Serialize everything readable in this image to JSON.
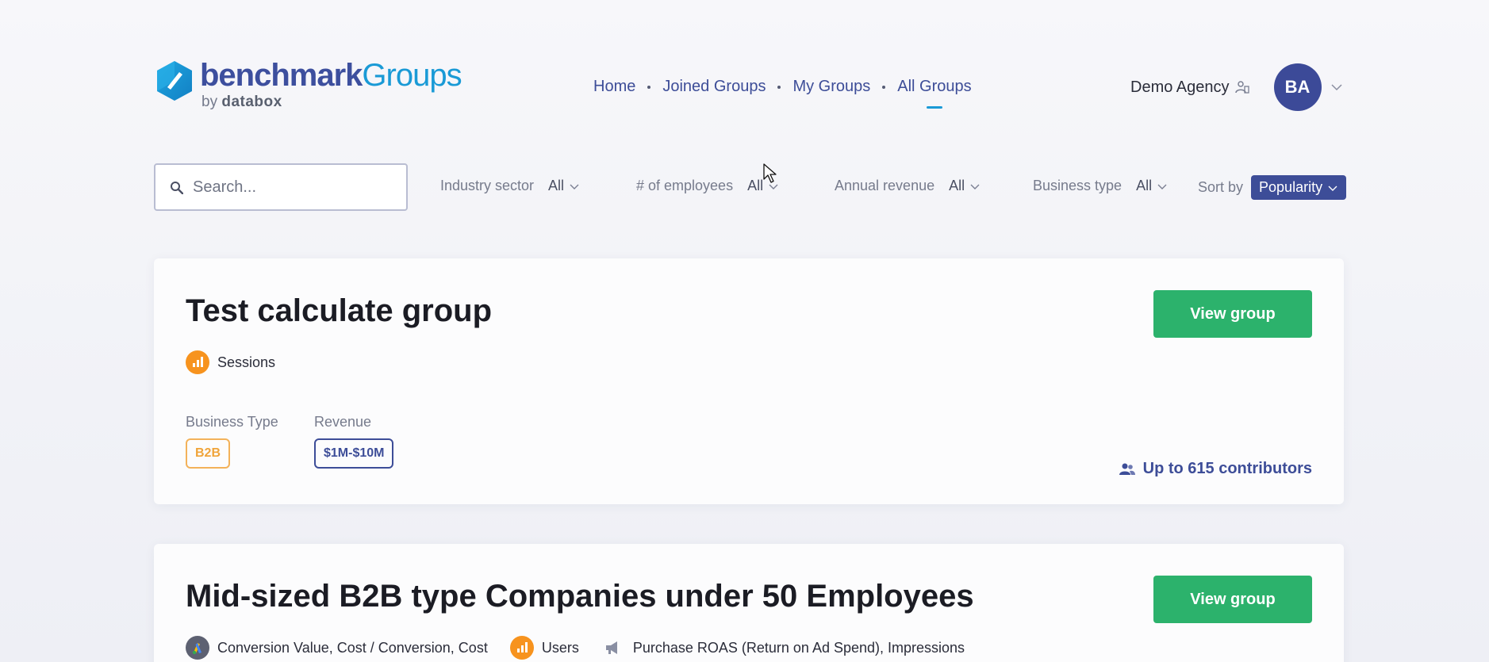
{
  "header": {
    "logo": {
      "brand_bold": "benchmark",
      "brand_light": "Groups",
      "by_label": "by",
      "by_brand": "databox"
    },
    "nav": [
      {
        "label": "Home",
        "active": false
      },
      {
        "label": "Joined Groups",
        "active": false
      },
      {
        "label": "My Groups",
        "active": false
      },
      {
        "label": "All Groups",
        "active": true
      }
    ],
    "account": {
      "name": "Demo Agency",
      "avatar_initials": "BA"
    }
  },
  "filters": {
    "search_placeholder": "Search...",
    "items": [
      {
        "label": "Industry sector",
        "value": "All"
      },
      {
        "label": "# of employees",
        "value": "All"
      },
      {
        "label": "Annual revenue",
        "value": "All"
      },
      {
        "label": "Business type",
        "value": "All"
      }
    ],
    "sort": {
      "label": "Sort by",
      "value": "Popularity"
    }
  },
  "groups": [
    {
      "title": "Test calculate group",
      "button": "View group",
      "metrics": [
        {
          "icon": "google-analytics-icon",
          "text": "Sessions"
        }
      ],
      "business_type_label": "Business Type",
      "business_type": "B2B",
      "revenue_label": "Revenue",
      "revenue": "$1M-$10M",
      "contributors": "Up to 615 contributors"
    },
    {
      "title": "Mid-sized B2B type Companies under 50 Employees",
      "button": "View group",
      "metrics": [
        {
          "icon": "google-ads-icon",
          "text": "Conversion Value, Cost / Conversion, Cost"
        },
        {
          "icon": "google-analytics-icon",
          "text": "Users"
        },
        {
          "icon": "megaphone-icon",
          "text": "Purchase ROAS (Return on Ad Spend), Impressions"
        }
      ]
    }
  ],
  "colors": {
    "brand_navy": "#3d4d98",
    "brand_blue": "#1a9ad6",
    "button_green": "#2cb26c",
    "tag_orange": "#f0a43a"
  }
}
